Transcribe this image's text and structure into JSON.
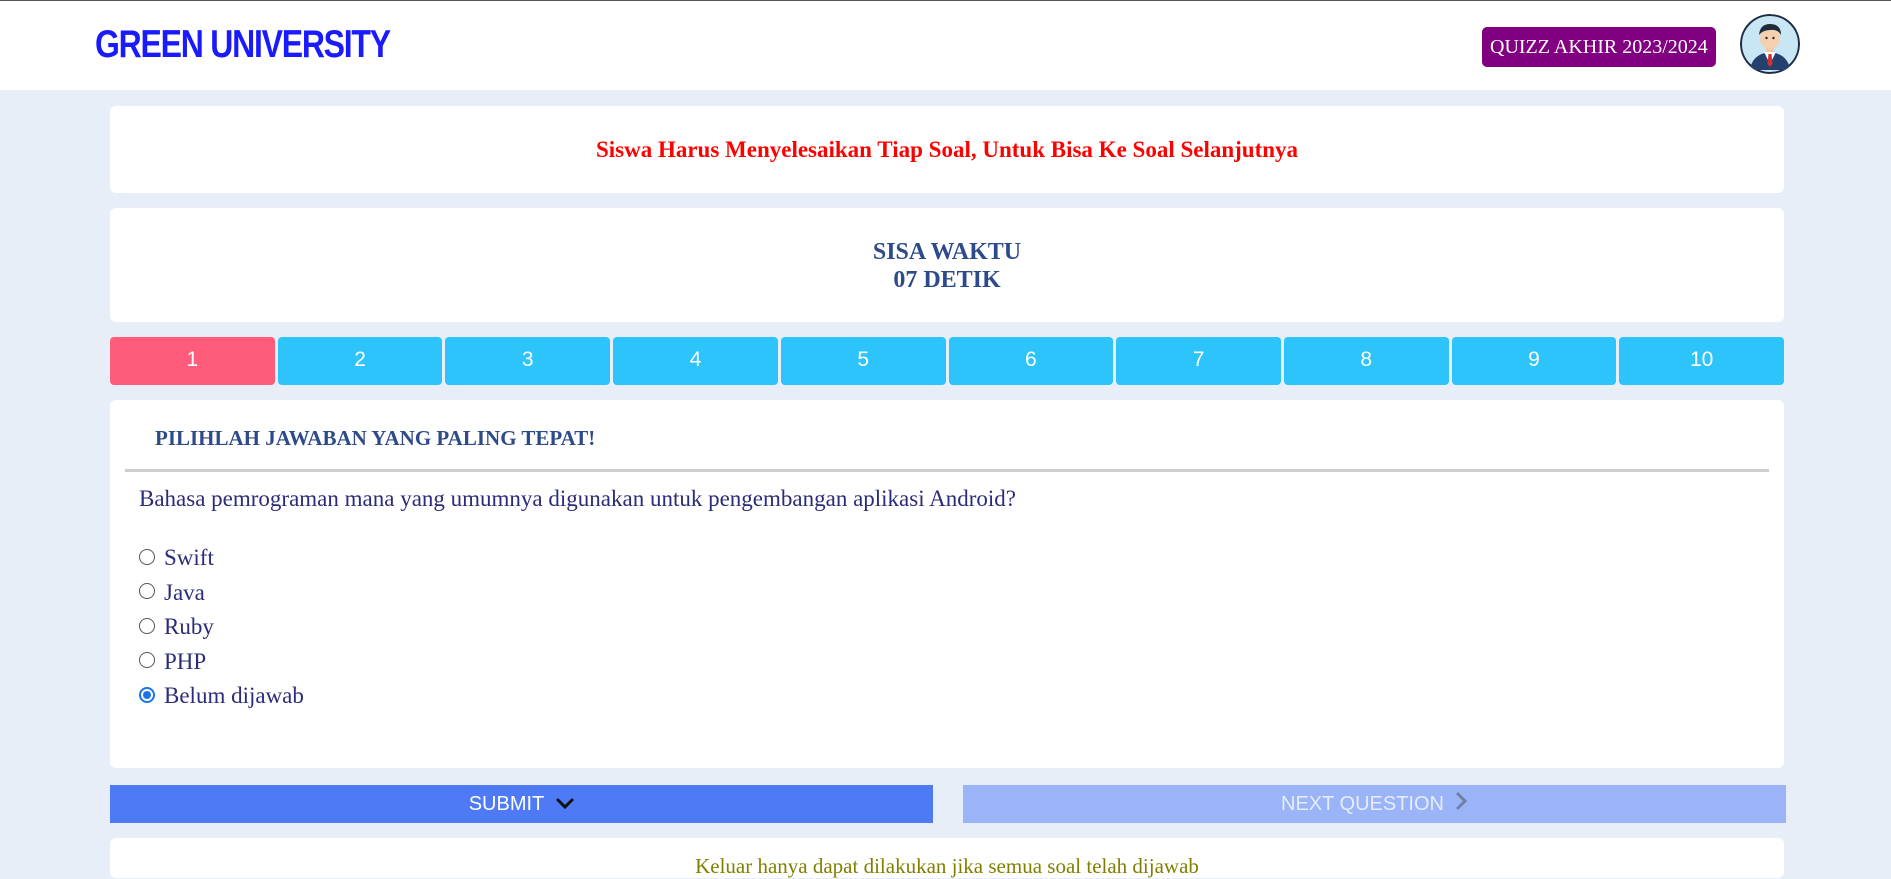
{
  "header": {
    "brand": "GREEN UNIVERSITY",
    "quiz_badge": "QUIZZ AKHIR 2023/2024",
    "avatar_icon": "user-avatar-icon"
  },
  "notice": "Siswa Harus Menyelesaikan Tiap Soal, Untuk Bisa Ke Soal Selanjutnya",
  "timer": {
    "label": "SISA WAKTU",
    "value": "07 DETIK"
  },
  "question_nav": {
    "active_index": 0,
    "items": [
      "1",
      "2",
      "3",
      "4",
      "5",
      "6",
      "7",
      "8",
      "9",
      "10"
    ],
    "colors": {
      "active": "#ff5c7c",
      "default": "#2dc3fb"
    }
  },
  "question": {
    "instruction": "PILIHLAH JAWABAN YANG PALING TEPAT!",
    "text": "Bahasa pemrograman mana yang umumnya digunakan untuk pengembangan aplikasi Android?",
    "options": [
      {
        "label": "Swift",
        "checked": false
      },
      {
        "label": "Java",
        "checked": false
      },
      {
        "label": "Ruby",
        "checked": false
      },
      {
        "label": "PHP",
        "checked": false
      },
      {
        "label": "Belum dijawab",
        "checked": true
      }
    ]
  },
  "actions": {
    "submit_label": "SUBMIT",
    "submit_icon": "chevron-down-icon",
    "next_label": "NEXT QUESTION",
    "next_icon": "chevron-right-icon"
  },
  "footer": {
    "text": "Keluar hanya dapat dilakukan jika semua soal telah dijawab"
  }
}
